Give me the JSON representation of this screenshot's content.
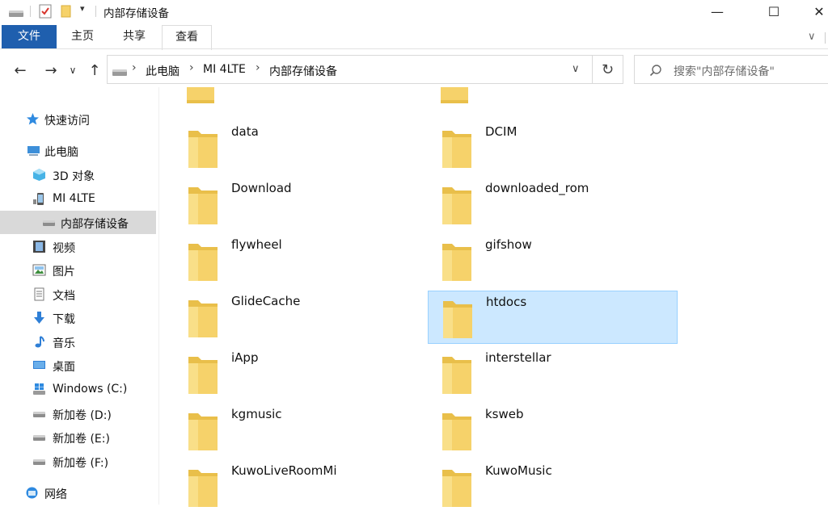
{
  "window": {
    "title": "内部存储设备",
    "buttons": {
      "minimize": "—",
      "maximize": "☐",
      "close": "✕"
    }
  },
  "ribbon": {
    "tabs": [
      "文件",
      "主页",
      "共享",
      "查看"
    ]
  },
  "address": {
    "crumbs": [
      "此电脑",
      "MI 4LTE",
      "内部存储设备"
    ],
    "search_placeholder": "搜索\"内部存储设备\""
  },
  "sidebar": {
    "items": [
      {
        "label": "快速访问",
        "icon": "star-icon"
      },
      {
        "label": "此电脑",
        "icon": "computer-icon"
      },
      {
        "label": "3D 对象",
        "icon": "cube-icon"
      },
      {
        "label": "MI 4LTE",
        "icon": "phone-icon"
      },
      {
        "label": "内部存储设备",
        "icon": "drive-icon",
        "selected": true
      },
      {
        "label": "视频",
        "icon": "video-icon"
      },
      {
        "label": "图片",
        "icon": "picture-icon"
      },
      {
        "label": "文档",
        "icon": "document-icon"
      },
      {
        "label": "下载",
        "icon": "download-icon"
      },
      {
        "label": "音乐",
        "icon": "music-icon"
      },
      {
        "label": "桌面",
        "icon": "desktop-icon"
      },
      {
        "label": "Windows (C:)",
        "icon": "windows-drive-icon"
      },
      {
        "label": "新加卷 (D:)",
        "icon": "drive-icon"
      },
      {
        "label": "新加卷 (E:)",
        "icon": "drive-icon"
      },
      {
        "label": "新加卷 (F:)",
        "icon": "drive-icon"
      },
      {
        "label": "网络",
        "icon": "network-icon"
      }
    ]
  },
  "content": {
    "folders_left": [
      "data",
      "Download",
      "flywheel",
      "GlideCache",
      "iApp",
      "kgmusic",
      "KuwoLiveRoomMi"
    ],
    "folders_right": [
      "DCIM",
      "downloaded_rom",
      "gifshow",
      "htdocs",
      "interstellar",
      "ksweb",
      "KuwoMusic"
    ],
    "selected_folder": "htdocs"
  },
  "colors": {
    "accent": "#1f5fae",
    "selection_bg": "#cce8ff",
    "selection_border": "#99d1ff",
    "folder": "#f6d26a"
  }
}
